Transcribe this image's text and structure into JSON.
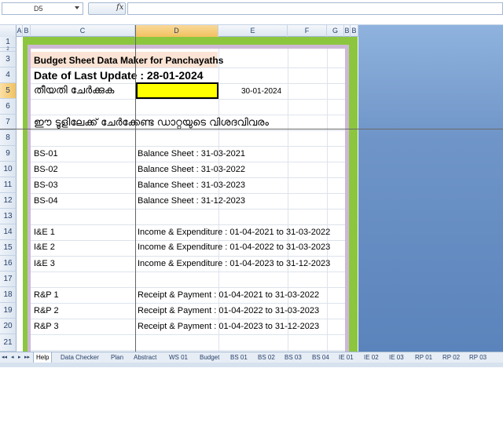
{
  "formula_bar": {
    "name_box": "D5",
    "fx": "fx",
    "formula": ""
  },
  "columns": [
    "A",
    "B",
    "C",
    "D",
    "E",
    "F",
    "G",
    "B",
    "B"
  ],
  "rows": [
    "1",
    "2",
    "3",
    "4",
    "5",
    "6",
    "7",
    "8",
    "9",
    "10",
    "11",
    "12",
    "13",
    "14",
    "15",
    "16",
    "17",
    "18",
    "19",
    "20",
    "21"
  ],
  "sheet": {
    "title": "Budget Sheet Data Maker for Panchayaths",
    "last_update": "Date of Last Update : 28-01-2024",
    "date_label": "തീയതി ചേർക്കുക",
    "date_value": "30-01-2024",
    "section_heading": "ഈ ടൂളിലേക്ക് ചേർക്കേണ്ട ഡാറ്റയുടെ വിശദവിവരം",
    "items": [
      {
        "code": "BS-01",
        "desc": "Balance Sheet  : 31-03-2021"
      },
      {
        "code": "BS-02",
        "desc": "Balance Sheet  : 31-03-2022"
      },
      {
        "code": "BS-03",
        "desc": "Balance Sheet  : 31-03-2023"
      },
      {
        "code": "BS-04",
        "desc": "Balance Sheet  : 31-12-2023"
      },
      {
        "code": "I&E 1",
        "desc": "Income & Expenditure : 01-04-2021 to 31-03-2022"
      },
      {
        "code": "I&E 2",
        "desc": "Income & Expenditure : 01-04-2022 to 31-03-2023"
      },
      {
        "code": "I&E 3",
        "desc": "Income & Expenditure : 01-04-2023 to 31-12-2023"
      },
      {
        "code": "R&P 1",
        "desc": "Receipt & Payment : 01-04-2021 to 31-03-2022"
      },
      {
        "code": "R&P 2",
        "desc": "Receipt & Payment : 01-04-2022 to 31-03-2023"
      },
      {
        "code": "R&P 3",
        "desc": "Receipt & Payment : 01-04-2023 to 31-12-2023"
      }
    ]
  },
  "tabs": [
    "Help",
    "Data Checker",
    "Plan",
    "Abstract",
    "WS 01",
    "Budget",
    "BS 01",
    "BS 02",
    "BS 03",
    "BS 04",
    "IE 01",
    "IE 02",
    "IE 03",
    "RP 01",
    "RP 02",
    "RP 03"
  ],
  "tab_nav": [
    "◂◂",
    "◂",
    "▸",
    "▸▸"
  ],
  "colors": {
    "frame_green": "#8cc63e",
    "frame_purple": "#cdb9d6",
    "highlight_yellow": "#ffff00",
    "title_fill": "#fbe4d5"
  }
}
